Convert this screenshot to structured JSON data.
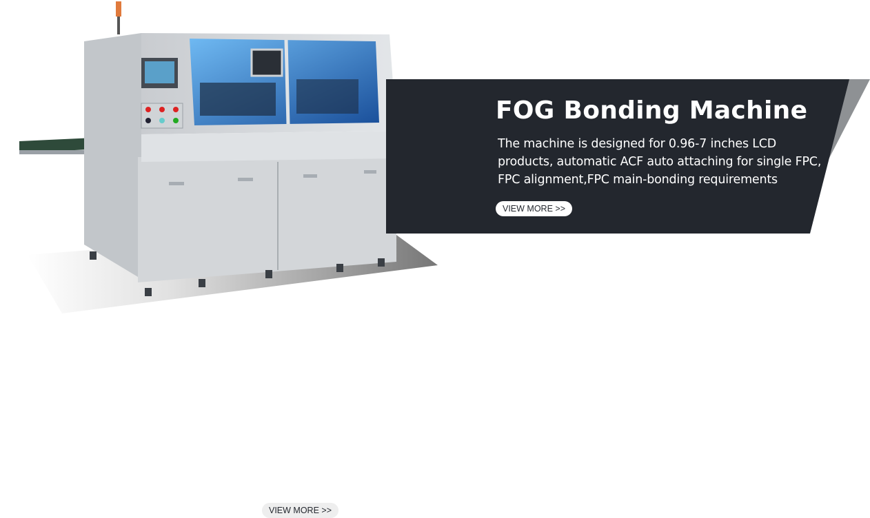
{
  "banner": {
    "title": "FOG Bonding Machine",
    "description": "The machine is designed for 0.96-7 inches LCD products, automatic ACF auto attaching for single FPC, FPC alignment,FPC main-bonding requirements",
    "cta_label": "VIEW MORE >>",
    "colors": {
      "panel": "#23272e",
      "accent": "#8e9194",
      "text": "#ffffff"
    }
  },
  "secondary_cta": {
    "label": "VIEW MORE >>"
  },
  "product_image": {
    "icon": "fog-bonding-machine-illustration"
  }
}
